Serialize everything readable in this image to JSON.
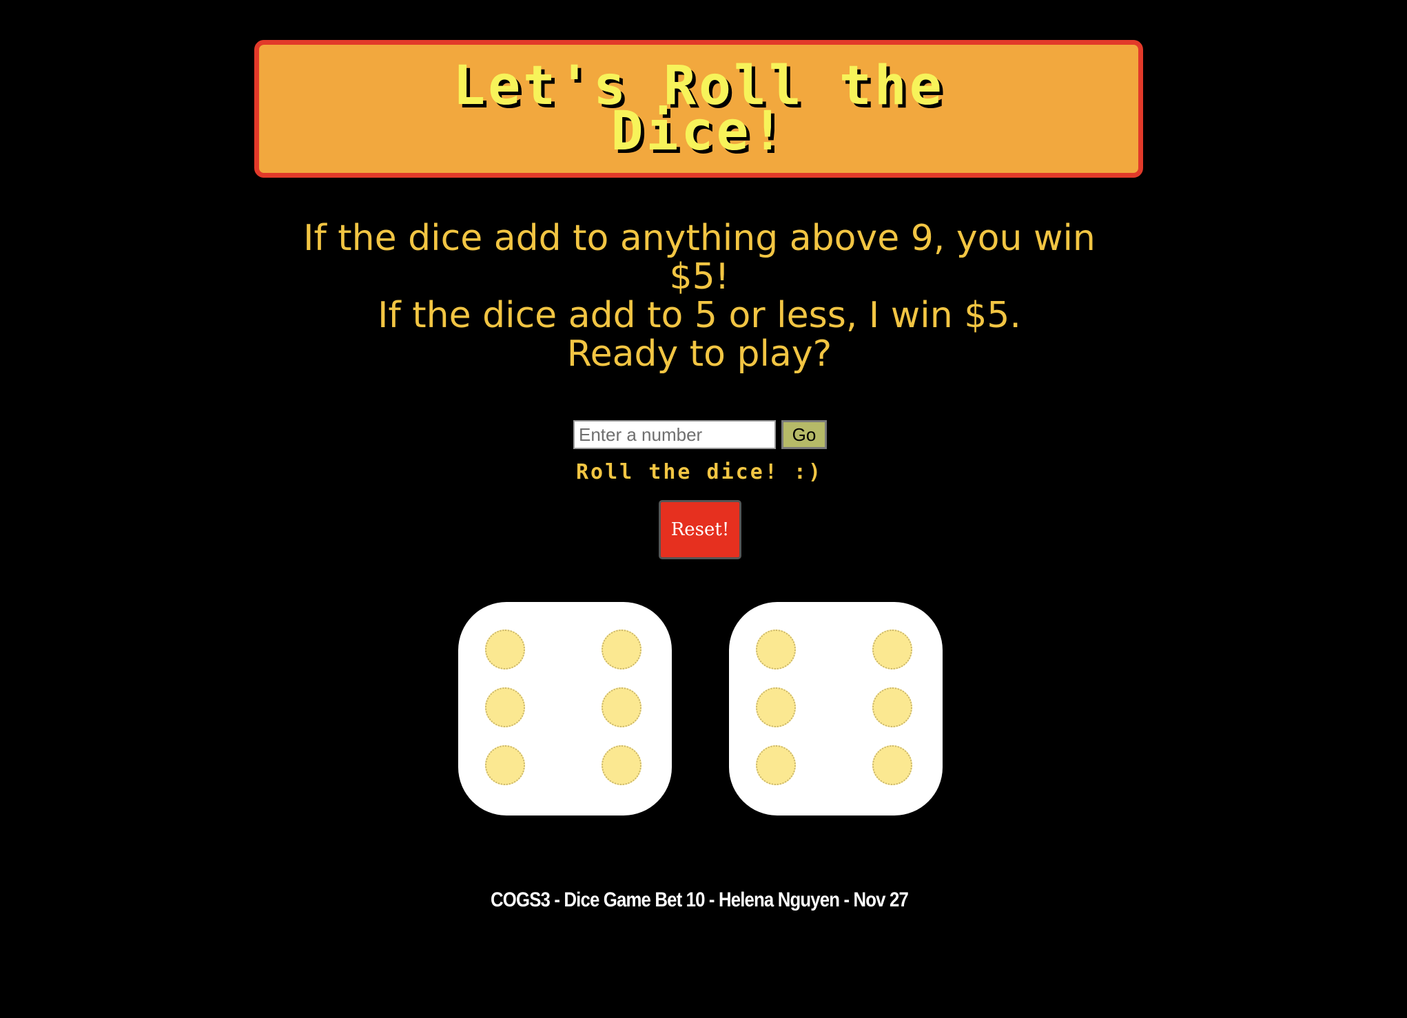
{
  "header": {
    "title": "Let's Roll the Dice!"
  },
  "rules": {
    "line1": "If the dice add to anything above 9, you win $5!",
    "line2": "If the dice add to 5 or less, I win $5.",
    "line3": "Ready to play?"
  },
  "controls": {
    "input_placeholder": "Enter a number",
    "input_value": "",
    "go_label": "Go"
  },
  "status": {
    "message": "Roll the dice! :)"
  },
  "reset": {
    "label": "Reset!"
  },
  "dice": [
    {
      "face": 6
    },
    {
      "face": 6
    }
  ],
  "footer": {
    "text": "COGS3 - Dice Game Bet 10 - Helena Nguyen - Nov 27"
  },
  "colors": {
    "background": "#000000",
    "title_box": "#f2a83e",
    "title_border": "#e23a2a",
    "title_text": "#f7f35a",
    "rules_text": "#f2c543",
    "reset_button": "#e6301f",
    "go_button": "#b6ba68",
    "pip": "#fbe891"
  }
}
